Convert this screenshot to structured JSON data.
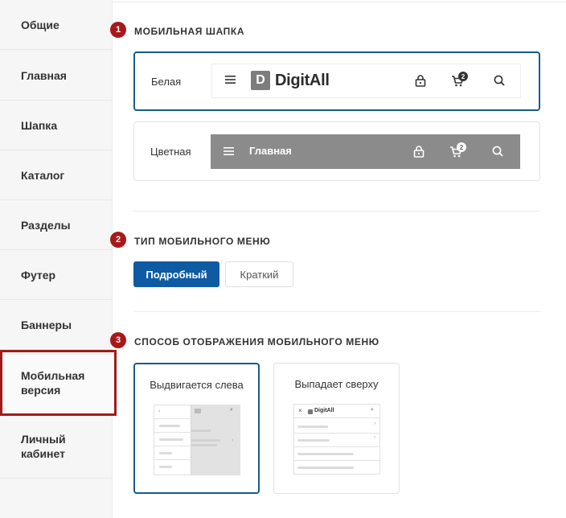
{
  "sidebar": {
    "items": [
      {
        "label": "Общие"
      },
      {
        "label": "Главная"
      },
      {
        "label": "Шапка"
      },
      {
        "label": "Каталог"
      },
      {
        "label": "Разделы"
      },
      {
        "label": "Футер"
      },
      {
        "label": "Баннеры"
      },
      {
        "label": "Мобильная версия"
      },
      {
        "label": "Личный кабинет"
      }
    ],
    "active_index": 7
  },
  "mobile_header": {
    "step": "1",
    "title": "МОБИЛЬНАЯ ШАПКА",
    "options": [
      {
        "label": "Белая",
        "selected": true,
        "logo_letter": "D",
        "logo_text": "DigitAll",
        "cart_count": "2"
      },
      {
        "label": "Цветная",
        "selected": false,
        "bar_title": "Главная",
        "cart_count": "2"
      }
    ]
  },
  "menu_type": {
    "step": "2",
    "title": "ТИП МОБИЛЬНОГО МЕНЮ",
    "options": [
      {
        "label": "Подробный",
        "selected": true
      },
      {
        "label": "Краткий",
        "selected": false
      }
    ]
  },
  "menu_display": {
    "step": "3",
    "title": "СПОСОБ ОТОБРАЖЕНИЯ МОБИЛЬНОГО МЕНЮ",
    "options": [
      {
        "label": "Выдвигается слева",
        "selected": true
      },
      {
        "label": "Выпадает сверху",
        "selected": false,
        "logo_text": "DigitAll"
      }
    ]
  },
  "colors": {
    "accent": "#0e5ba3",
    "selected_border": "#1a5a8f",
    "badge": "#a8181a",
    "highlight": "#a11b1b",
    "colored_header": "#8b8b8b"
  }
}
